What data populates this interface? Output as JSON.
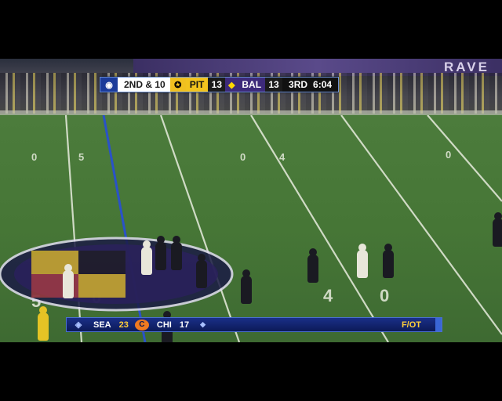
{
  "scorebug": {
    "network_icon": "cbs-eye-icon",
    "network_glyph": "◉",
    "down_distance": "2ND & 10",
    "team1": {
      "abbr": "PIT",
      "score": "13",
      "logo": "steelers-logo-icon",
      "logo_glyph": "✪",
      "color": "#f2c31e"
    },
    "team2": {
      "abbr": "BAL",
      "score": "13",
      "logo": "ravens-logo-icon",
      "logo_glyph": "◆",
      "color": "#3d2a7a"
    },
    "quarter": "3RD",
    "clock": "6:04"
  },
  "ticker": {
    "logo": "nfl-network-icon",
    "logo_glyph": "◈",
    "team_a": "SEA",
    "score_a": "23",
    "team_b_logo": "bears-logo-icon",
    "team_b_logo_glyph": "C",
    "team_b": "CHI",
    "score_b": "17",
    "league_badge_glyph": "◆",
    "status": "F/OT"
  },
  "stadium": {
    "banner_text": "RAVE"
  },
  "field": {
    "yard_numbers": [
      "0",
      "5",
      "0",
      "4",
      "0",
      "5",
      "0",
      "4",
      "0"
    ]
  }
}
